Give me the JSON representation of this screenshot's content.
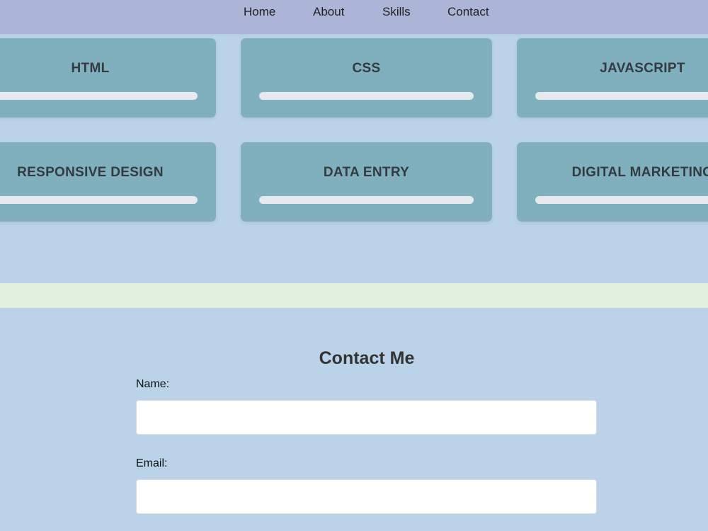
{
  "nav": {
    "items": [
      {
        "label": "Home"
      },
      {
        "label": "About"
      },
      {
        "label": "Skills"
      },
      {
        "label": "Contact"
      }
    ]
  },
  "skills": {
    "items": [
      {
        "label": "HTML"
      },
      {
        "label": "CSS"
      },
      {
        "label": "JAVASCRIPT"
      },
      {
        "label": "RESPONSIVE DESIGN"
      },
      {
        "label": "DATA ENTRY"
      },
      {
        "label": "DIGITAL MARKETING"
      }
    ]
  },
  "contact": {
    "title": "Contact Me",
    "name_label": "Name:",
    "name_value": "",
    "email_label": "Email:",
    "email_value": ""
  },
  "colors": {
    "page_bg": "#bad3e8",
    "nav_bg": "#acb4d8",
    "card_bg": "#80b0be",
    "bar": "#e6e9ee",
    "band": "#e2f1df"
  }
}
